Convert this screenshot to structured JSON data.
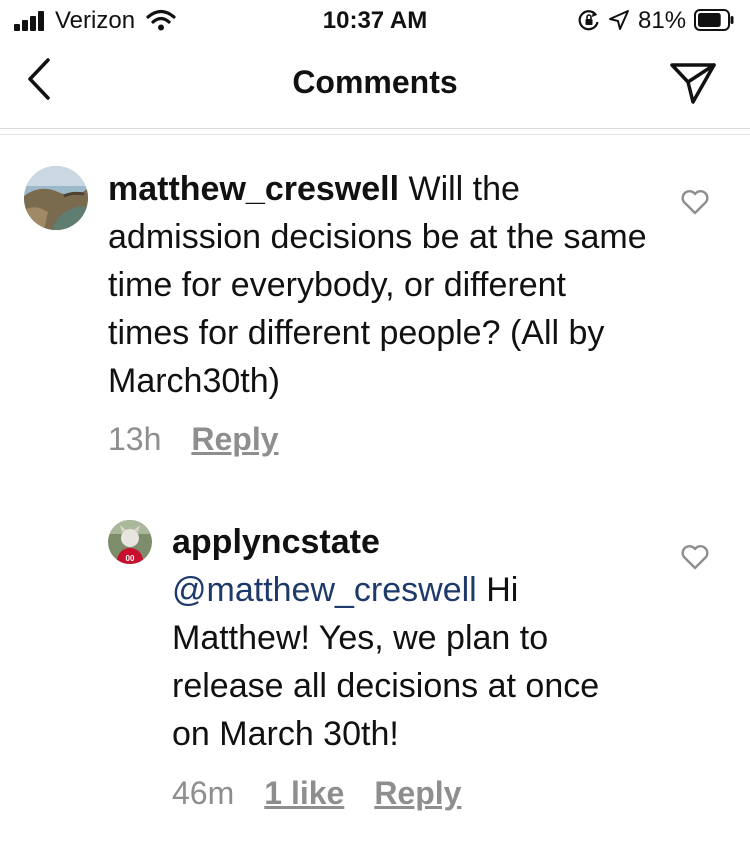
{
  "status_bar": {
    "carrier": "Verizon",
    "time": "10:37 AM",
    "battery_percent": "81%",
    "battery_level": 0.81
  },
  "header": {
    "title": "Comments",
    "back_icon": "chevron-left-icon",
    "send_icon": "paper-plane-icon"
  },
  "comments": [
    {
      "username": "matthew_creswell",
      "text": "Will the admission decisions be at the same time for everybody, or different times for different people? (All by March30th)",
      "time": "13h",
      "reply_label": "Reply",
      "like_icon": "heart-outline-icon"
    },
    {
      "username": "applyncstate",
      "mention": "@matthew_creswell",
      "text": "Hi Matthew! Yes, we plan to release all decisions at once on March 30th!",
      "time": "46m",
      "likes_label": "1 like",
      "reply_label": "Reply",
      "like_icon": "heart-outline-icon"
    }
  ]
}
